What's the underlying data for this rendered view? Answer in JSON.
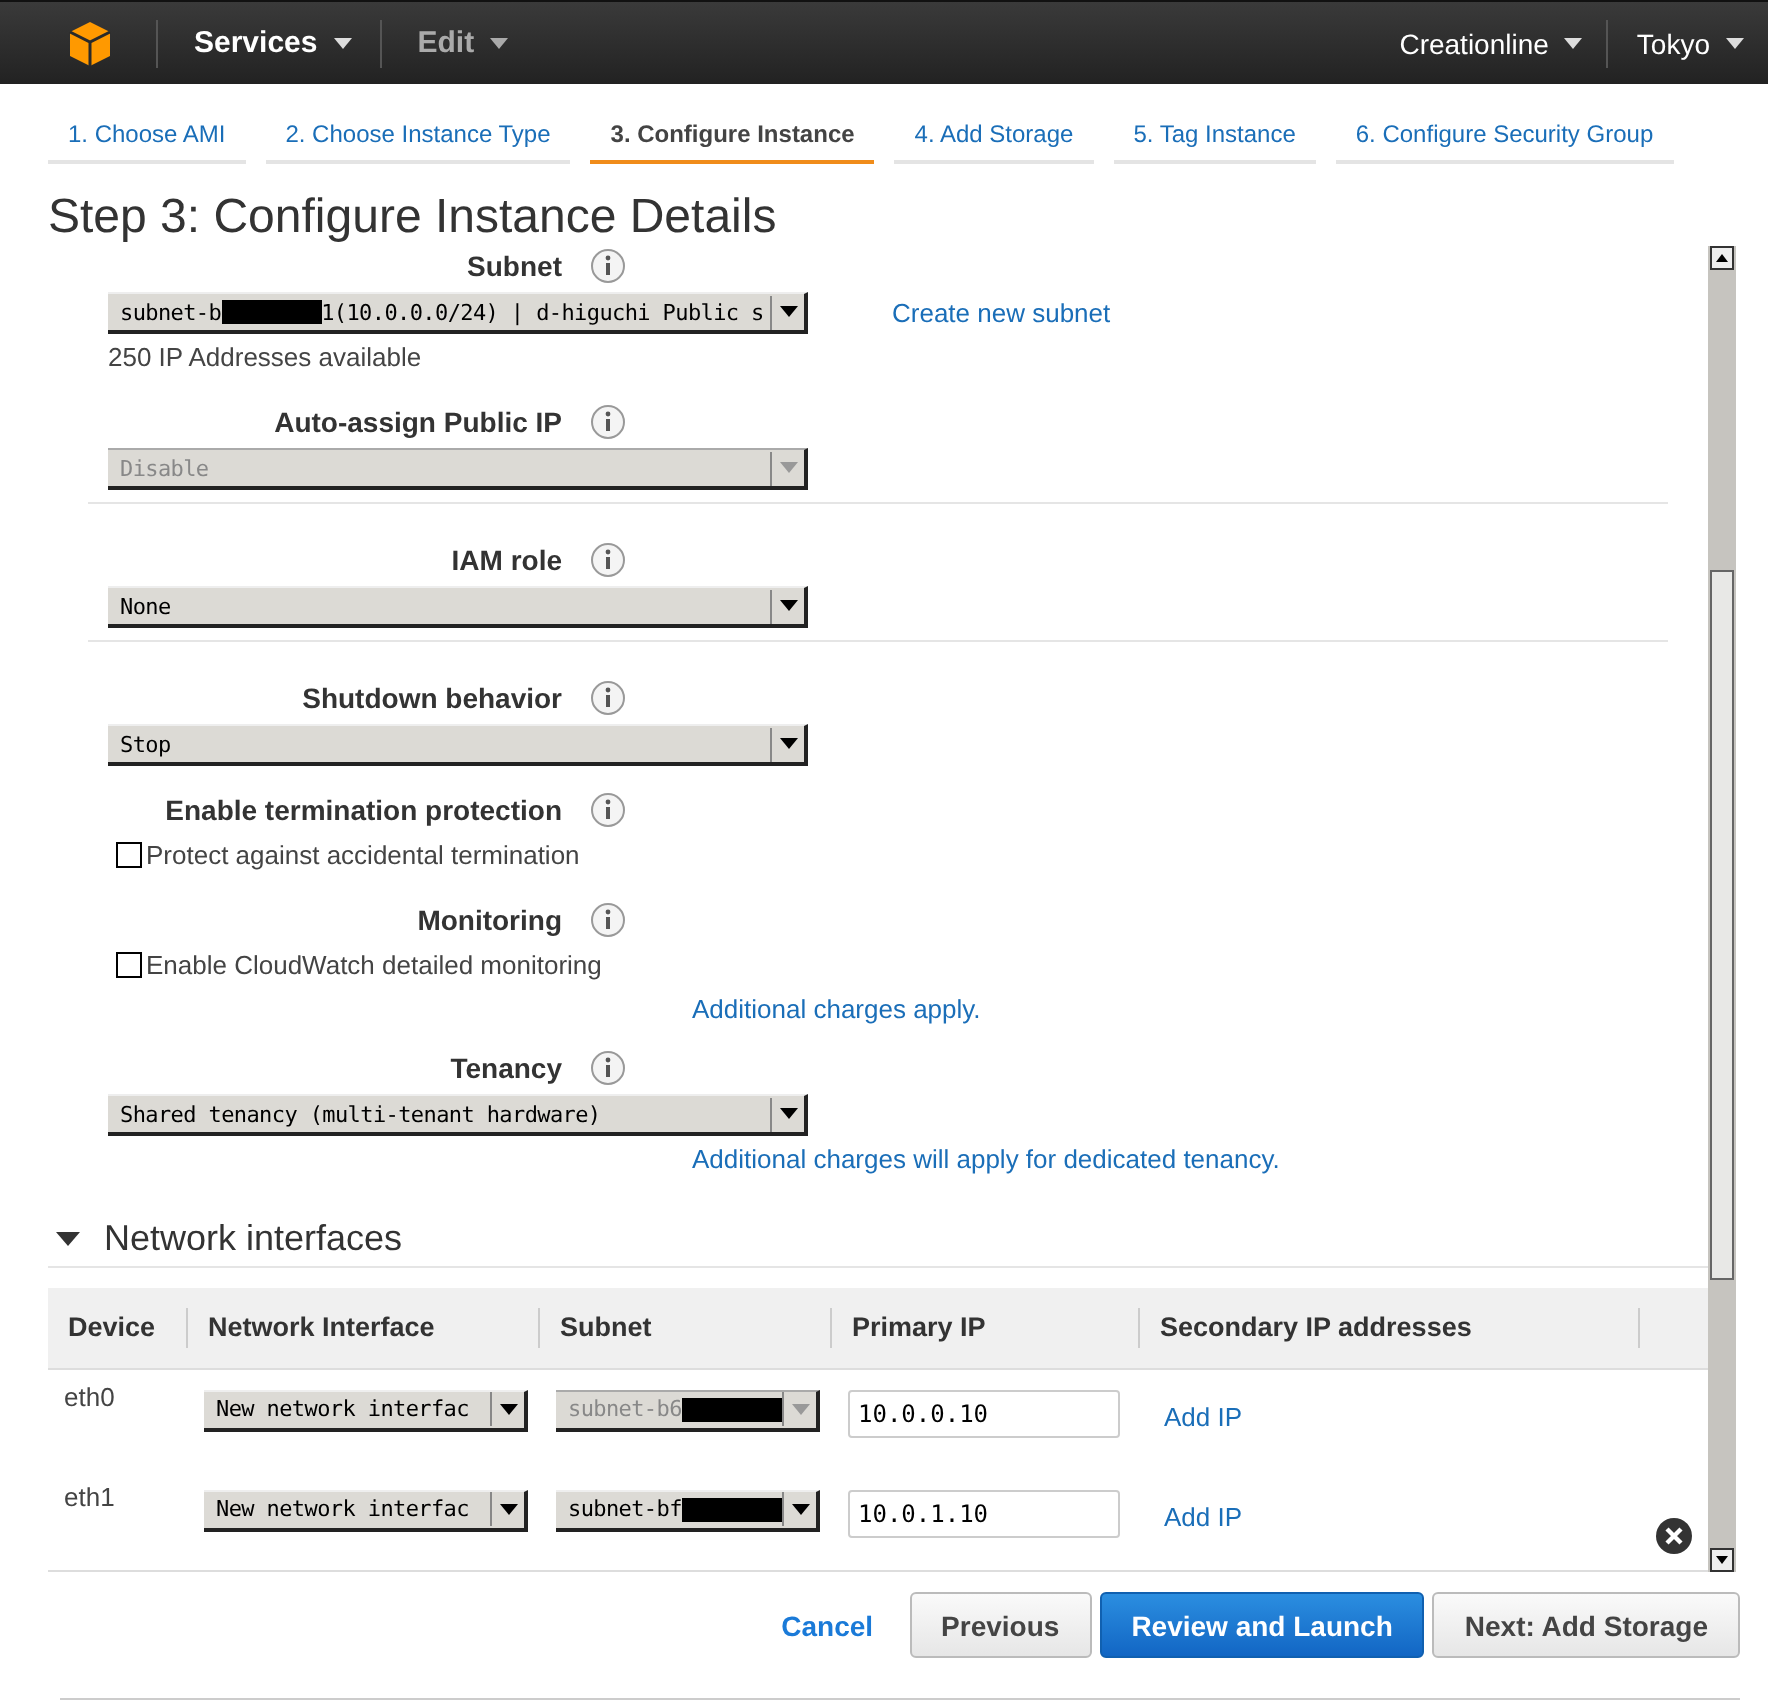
{
  "nav": {
    "services": "Services",
    "edit": "Edit",
    "account": "Creationline",
    "region": "Tokyo"
  },
  "wizard_tabs": [
    {
      "label": "1. Choose AMI",
      "selected": false
    },
    {
      "label": "2. Choose Instance Type",
      "selected": false
    },
    {
      "label": "3. Configure Instance",
      "selected": true
    },
    {
      "label": "4. Add Storage",
      "selected": false
    },
    {
      "label": "5. Tag Instance",
      "selected": false
    },
    {
      "label": "6. Configure Security Group",
      "selected": false
    }
  ],
  "step_title": "Step 3: Configure Instance Details",
  "groups": [
    [
      {
        "label": "Subnet",
        "kind": "select",
        "disabled": false,
        "value": [
          {
            "kind": "text",
            "text": "subnet-b"
          },
          {
            "kind": "redaction"
          },
          {
            "kind": "text",
            "text": "1(10.0.0.0/24) | d-higuchi Public s"
          }
        ],
        "side_link": "Create new subnet",
        "note": "250 IP Addresses available"
      },
      {
        "label": "Auto-assign Public IP",
        "kind": "select",
        "disabled": true,
        "value": [
          {
            "kind": "text",
            "text": "Disable"
          }
        ]
      }
    ],
    [
      {
        "label": "IAM role",
        "kind": "select",
        "disabled": false,
        "value": [
          {
            "kind": "text",
            "text": "None"
          }
        ]
      }
    ],
    [
      {
        "label": "Shutdown behavior",
        "kind": "select",
        "disabled": false,
        "value": [
          {
            "kind": "text",
            "text": "Stop"
          }
        ]
      },
      {
        "label": "Enable termination protection",
        "kind": "checkbox",
        "checked": false,
        "option": "Protect against accidental termination"
      },
      {
        "label": "Monitoring",
        "kind": "checkbox",
        "checked": false,
        "option": "Enable CloudWatch detailed monitoring",
        "link_below": "Additional charges apply."
      },
      {
        "label": "Tenancy",
        "kind": "select",
        "disabled": false,
        "value": [
          {
            "kind": "text",
            "text": "Shared tenancy (multi-tenant hardware)"
          }
        ],
        "link_below": "Additional charges will apply for dedicated tenancy."
      }
    ]
  ],
  "network": {
    "title": "Network interfaces",
    "expanded": true,
    "columns": [
      "Device",
      "Network Interface",
      "Subnet",
      "Primary IP",
      "Secondary IP addresses"
    ],
    "rows": [
      {
        "device": "eth0",
        "interface": "New network interfac",
        "subnet": [
          {
            "kind": "text",
            "text": "subnet-b6"
          },
          {
            "kind": "redaction"
          }
        ],
        "subnet_disabled": true,
        "primary_ip": "10.0.0.10",
        "add_ip": "Add IP",
        "removable": false
      },
      {
        "device": "eth1",
        "interface": "New network interfac",
        "subnet": [
          {
            "kind": "text",
            "text": "subnet-bf"
          },
          {
            "kind": "redaction"
          }
        ],
        "subnet_disabled": false,
        "primary_ip": "10.0.1.10",
        "add_ip": "Add IP",
        "removable": true
      }
    ]
  },
  "buttons": [
    {
      "label": "Cancel",
      "kind": "link"
    },
    {
      "label": "Previous",
      "kind": "secondary"
    },
    {
      "label": "Review and Launch",
      "kind": "primary"
    },
    {
      "label": "Next: Add Storage",
      "kind": "secondary"
    }
  ]
}
